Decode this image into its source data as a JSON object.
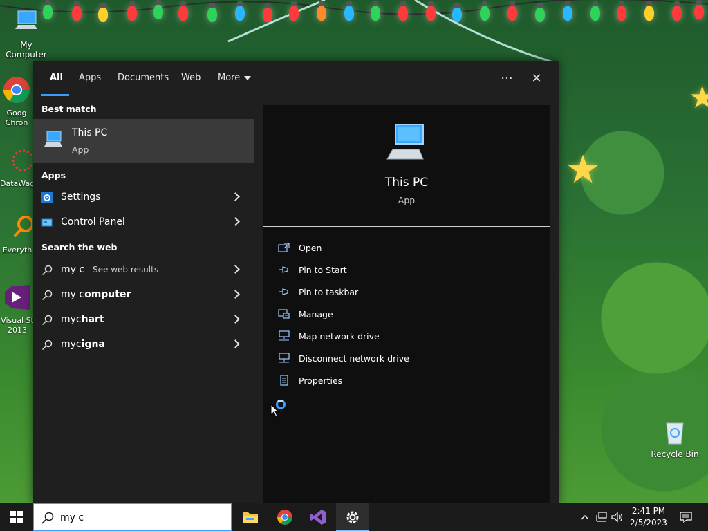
{
  "desktop": {
    "icons": [
      {
        "id": "my-computer",
        "label": "My Computer"
      },
      {
        "id": "chrome",
        "label": "Goog\nChron"
      },
      {
        "id": "datawag",
        "label": "DataWag"
      },
      {
        "id": "everything",
        "label": "Everyth"
      },
      {
        "id": "visual-studio",
        "label": "Visual St\n2013"
      },
      {
        "id": "recycle-bin",
        "label": "Recycle Bin"
      }
    ]
  },
  "search": {
    "tabs": [
      {
        "label": "All",
        "active": true
      },
      {
        "label": "Apps",
        "active": false
      },
      {
        "label": "Documents",
        "active": false
      },
      {
        "label": "Web",
        "active": false
      },
      {
        "label": "More",
        "active": false
      }
    ],
    "more_options_glyph": "···",
    "close_glyph": "✕",
    "sections": {
      "best_match": "Best match",
      "apps": "Apps",
      "search_web": "Search the web"
    },
    "best_match": {
      "title": "This PC",
      "kind": "App"
    },
    "apps": [
      {
        "label": "Settings",
        "icon": "gear-icon"
      },
      {
        "label": "Control Panel",
        "icon": "control-panel-icon"
      }
    ],
    "web": [
      {
        "prefix": "my c",
        "bold": "",
        "suffix": " - See web results"
      },
      {
        "prefix": "my c",
        "bold": "omputer",
        "suffix": ""
      },
      {
        "prefix": "myc",
        "bold": "hart",
        "suffix": ""
      },
      {
        "prefix": "myc",
        "bold": "igna",
        "suffix": ""
      }
    ],
    "preview": {
      "title": "This PC",
      "kind": "App",
      "actions": [
        {
          "label": "Open",
          "icon": "open-icon"
        },
        {
          "label": "Pin to Start",
          "icon": "pin-icon"
        },
        {
          "label": "Pin to taskbar",
          "icon": "pin-icon"
        },
        {
          "label": "Manage",
          "icon": "manage-icon"
        },
        {
          "label": "Map network drive",
          "icon": "network-drive-icon"
        },
        {
          "label": "Disconnect network drive",
          "icon": "network-drive-icon"
        },
        {
          "label": "Properties",
          "icon": "properties-icon"
        }
      ]
    }
  },
  "taskbar": {
    "search_value": "my c",
    "clock_time": "2:41 PM",
    "clock_date": "2/5/2023",
    "accent": "#3c9bff"
  }
}
